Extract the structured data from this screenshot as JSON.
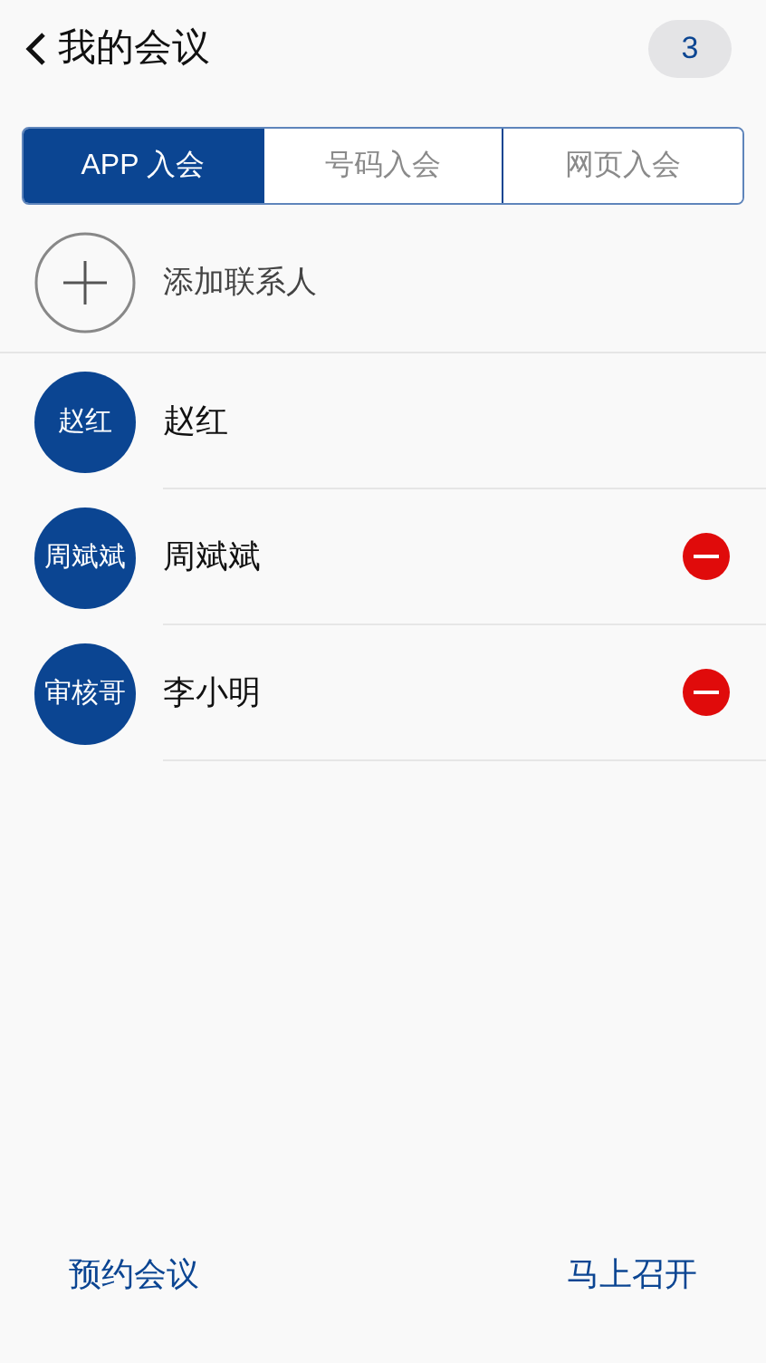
{
  "header": {
    "title": "我的会议",
    "count": "3"
  },
  "tabs": [
    {
      "label": "APP 入会",
      "selected": true
    },
    {
      "label": "号码入会",
      "selected": false
    },
    {
      "label": "网页入会",
      "selected": false
    }
  ],
  "add_contact": {
    "label": "添加联系人"
  },
  "participants": [
    {
      "avatar_text": "赵红",
      "name": "赵红",
      "removable": false
    },
    {
      "avatar_text": "周斌斌",
      "name": "周斌斌",
      "removable": true
    },
    {
      "avatar_text": "审核哥",
      "name": "李小明",
      "removable": true
    }
  ],
  "actions": [
    "预约会议",
    "马上召开"
  ]
}
